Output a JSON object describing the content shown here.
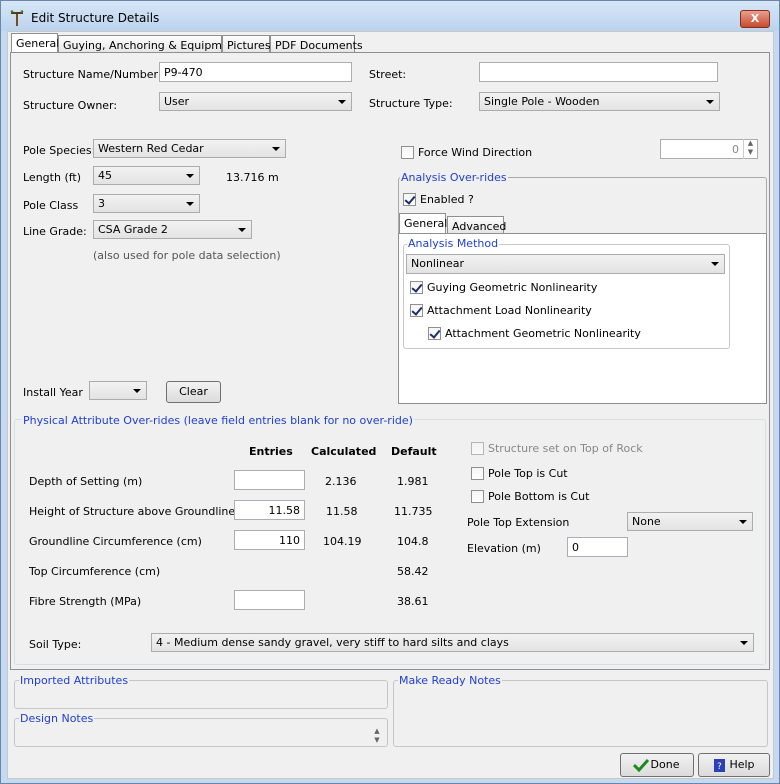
{
  "window": {
    "title": "Edit Structure Details",
    "close": "X"
  },
  "tabs": [
    "General",
    "Guying, Anchoring & Equipment",
    "Pictures",
    "PDF Documents"
  ],
  "general": {
    "name_label": "Structure Name/Number:",
    "name_value": "P9-470",
    "street_label": "Street:",
    "street_value": "",
    "owner_label": "Structure Owner:",
    "owner_value": "User",
    "type_label": "Structure Type:",
    "type_value": "Single Pole - Wooden",
    "species_label": "Pole Species:",
    "species_value": "Western Red Cedar",
    "length_label": "Length (ft)",
    "length_value": "45",
    "length_metric": "13.716 m",
    "class_label": "Pole Class",
    "class_value": "3",
    "grade_label": "Line Grade:",
    "grade_value": "CSA Grade 2",
    "grade_note": "(also used for pole data selection)",
    "install_label": "Install Year",
    "install_value": "",
    "clear_label": "Clear",
    "force_wind_label": "Force Wind Direction",
    "force_wind_value": "0"
  },
  "overrides": {
    "title": "Analysis Over-rides",
    "enabled_label": "Enabled ?",
    "tabs": [
      "General",
      "Advanced"
    ],
    "method_title": "Analysis Method",
    "method_value": "Nonlinear",
    "guying_geo": "Guying Geometric Nonlinearity",
    "attach_load": "Attachment Load Nonlinearity",
    "attach_geo": "Attachment Geometric Nonlinearity"
  },
  "physical": {
    "title": "Physical Attribute Over-rides (leave field entries blank for no over-ride)",
    "col_entries": "Entries",
    "col_calc": "Calculated",
    "col_default": "Default",
    "rows": [
      {
        "label": "Depth of Setting (m)",
        "entry": "",
        "calc": "2.136",
        "default": "1.981"
      },
      {
        "label": "Height of Structure above Groundline (m)",
        "entry": "11.58",
        "calc": "11.58",
        "default": "11.735"
      },
      {
        "label": "Groundline Circumference (cm)",
        "entry": "110",
        "calc": "104.19",
        "default": "104.8"
      },
      {
        "label": "Top Circumference (cm)",
        "entry": "",
        "calc": "",
        "default": "58.42"
      },
      {
        "label": "Fibre Strength (MPa)",
        "entry": "",
        "calc": "",
        "default": "38.61"
      }
    ],
    "rock_label": "Structure set on Top of Rock",
    "top_cut_label": "Pole Top is Cut",
    "bottom_cut_label": "Pole Bottom is Cut",
    "extension_label": "Pole Top Extension",
    "extension_value": "None",
    "elevation_label": "Elevation (m)",
    "elevation_value": "0",
    "soil_label": "Soil Type:",
    "soil_value": "4 - Medium dense sandy gravel, very stiff to hard silts and clays"
  },
  "notes": {
    "imported": "Imported Attributes",
    "make_ready": "Make Ready Notes",
    "design": "Design Notes"
  },
  "buttons": {
    "done": "Done",
    "help": "Help"
  }
}
